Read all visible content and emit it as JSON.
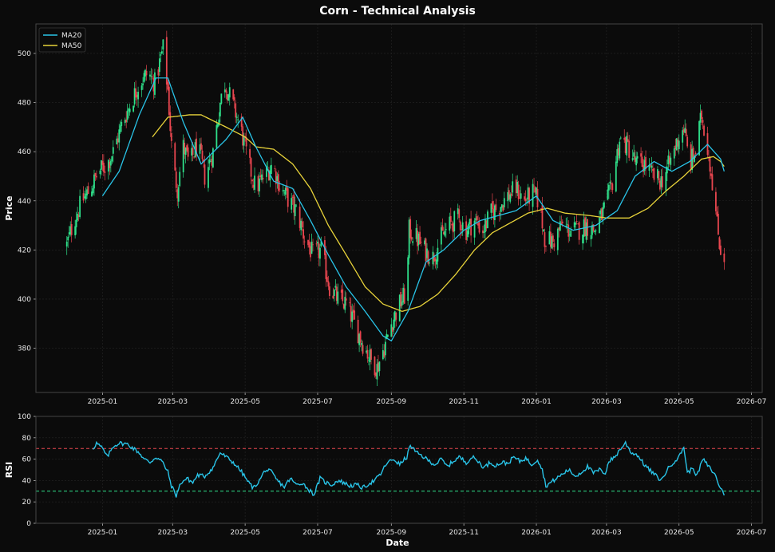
{
  "title": "Corn - Technical Analysis",
  "colors": {
    "background": "#0b0b0b",
    "up": "#2fe08a",
    "down": "#e8464f",
    "ma20": "#29c4e8",
    "ma50": "#e8d33a",
    "rsi": "#29c4e8",
    "overbought": "#e8464f",
    "oversold": "#2fe08a",
    "grid": "#262626",
    "spine": "#444444"
  },
  "chart_data": [
    {
      "type": "candlestick",
      "ylabel": "Price",
      "ylim": [
        362,
        512
      ],
      "xlim": [
        "2024-11-06",
        "2026-07-10"
      ],
      "yticks": [
        380,
        400,
        420,
        440,
        460,
        480,
        500
      ],
      "xticks": [
        "2025-01",
        "2025-03",
        "2025-05",
        "2025-07",
        "2025-09",
        "2025-11",
        "2026-01",
        "2026-03",
        "2026-05",
        "2026-07"
      ],
      "grid": true,
      "legend": {
        "position": "top-left",
        "entries": [
          "MA20",
          "MA50"
        ]
      },
      "close_anchors": [
        [
          "2024-12-02",
          422
        ],
        [
          "2024-12-08",
          432
        ],
        [
          "2024-12-15",
          440
        ],
        [
          "2024-12-22",
          445
        ],
        [
          "2024-12-29",
          452
        ],
        [
          "2025-01-05",
          455
        ],
        [
          "2025-01-10",
          460
        ],
        [
          "2025-01-18",
          472
        ],
        [
          "2025-01-25",
          480
        ],
        [
          "2025-02-01",
          488
        ],
        [
          "2025-02-08",
          492
        ],
        [
          "2025-02-14",
          488
        ],
        [
          "2025-02-18",
          496
        ],
        [
          "2025-02-21",
          502
        ],
        [
          "2025-02-25",
          485
        ],
        [
          "2025-03-01",
          455
        ],
        [
          "2025-03-05",
          445
        ],
        [
          "2025-03-10",
          462
        ],
        [
          "2025-03-15",
          455
        ],
        [
          "2025-03-22",
          463
        ],
        [
          "2025-03-28",
          450
        ],
        [
          "2025-04-04",
          460
        ],
        [
          "2025-04-10",
          480
        ],
        [
          "2025-04-14",
          488
        ],
        [
          "2025-04-20",
          480
        ],
        [
          "2025-04-27",
          470
        ],
        [
          "2025-05-04",
          455
        ],
        [
          "2025-05-10",
          445
        ],
        [
          "2025-05-17",
          450
        ],
        [
          "2025-05-24",
          455
        ],
        [
          "2025-05-31",
          445
        ],
        [
          "2025-06-07",
          440
        ],
        [
          "2025-06-14",
          435
        ],
        [
          "2025-06-20",
          425
        ],
        [
          "2025-06-27",
          418
        ],
        [
          "2025-07-04",
          420
        ],
        [
          "2025-07-11",
          405
        ],
        [
          "2025-07-18",
          400
        ],
        [
          "2025-07-25",
          398
        ],
        [
          "2025-08-01",
          390
        ],
        [
          "2025-08-08",
          382
        ],
        [
          "2025-08-15",
          375
        ],
        [
          "2025-08-20",
          372
        ],
        [
          "2025-08-27",
          382
        ],
        [
          "2025-09-01",
          390
        ],
        [
          "2025-09-08",
          398
        ],
        [
          "2025-09-14",
          403
        ],
        [
          "2025-09-16",
          428
        ],
        [
          "2025-09-22",
          425
        ],
        [
          "2025-09-29",
          420
        ],
        [
          "2025-10-06",
          417
        ],
        [
          "2025-10-13",
          425
        ],
        [
          "2025-10-20",
          430
        ],
        [
          "2025-10-27",
          433
        ],
        [
          "2025-11-03",
          428
        ],
        [
          "2025-11-10",
          432
        ],
        [
          "2025-11-17",
          428
        ],
        [
          "2025-11-24",
          435
        ],
        [
          "2025-12-01",
          438
        ],
        [
          "2025-12-08",
          442
        ],
        [
          "2025-12-15",
          445
        ],
        [
          "2025-12-22",
          440
        ],
        [
          "2025-12-29",
          443
        ],
        [
          "2026-01-03",
          440
        ],
        [
          "2026-01-08",
          425
        ],
        [
          "2026-01-15",
          423
        ],
        [
          "2026-01-22",
          430
        ],
        [
          "2026-01-29",
          428
        ],
        [
          "2026-02-05",
          428
        ],
        [
          "2026-02-12",
          430
        ],
        [
          "2026-02-19",
          428
        ],
        [
          "2026-02-26",
          435
        ],
        [
          "2026-03-05",
          445
        ],
        [
          "2026-03-12",
          465
        ],
        [
          "2026-03-19",
          462
        ],
        [
          "2026-03-26",
          455
        ],
        [
          "2026-04-02",
          455
        ],
        [
          "2026-04-09",
          450
        ],
        [
          "2026-04-16",
          448
        ],
        [
          "2026-04-23",
          455
        ],
        [
          "2026-04-30",
          465
        ],
        [
          "2026-05-05",
          470
        ],
        [
          "2026-05-10",
          455
        ],
        [
          "2026-05-15",
          460
        ],
        [
          "2026-05-20",
          475
        ],
        [
          "2026-05-25",
          462
        ],
        [
          "2026-05-30",
          445
        ],
        [
          "2026-06-02",
          430
        ],
        [
          "2026-06-05",
          420
        ],
        [
          "2026-06-08",
          418
        ]
      ],
      "ma20_anchors": [
        [
          "2025-01-01",
          442
        ],
        [
          "2025-01-15",
          452
        ],
        [
          "2025-02-01",
          475
        ],
        [
          "2025-02-15",
          490
        ],
        [
          "2025-02-25",
          490
        ],
        [
          "2025-03-10",
          472
        ],
        [
          "2025-03-25",
          455
        ],
        [
          "2025-04-15",
          465
        ],
        [
          "2025-04-29",
          474
        ],
        [
          "2025-05-10",
          462
        ],
        [
          "2025-05-25",
          448
        ],
        [
          "2025-06-10",
          445
        ],
        [
          "2025-06-25",
          432
        ],
        [
          "2025-07-10",
          418
        ],
        [
          "2025-07-25",
          405
        ],
        [
          "2025-08-10",
          395
        ],
        [
          "2025-08-25",
          385
        ],
        [
          "2025-09-01",
          383
        ],
        [
          "2025-09-15",
          395
        ],
        [
          "2025-09-30",
          415
        ],
        [
          "2025-10-15",
          420
        ],
        [
          "2025-11-01",
          428
        ],
        [
          "2025-11-15",
          432
        ],
        [
          "2025-12-15",
          436
        ],
        [
          "2026-01-01",
          442
        ],
        [
          "2026-01-15",
          432
        ],
        [
          "2026-02-01",
          428
        ],
        [
          "2026-02-20",
          430
        ],
        [
          "2026-03-10",
          436
        ],
        [
          "2026-03-25",
          450
        ],
        [
          "2026-04-10",
          456
        ],
        [
          "2026-04-25",
          452
        ],
        [
          "2026-05-10",
          456
        ],
        [
          "2026-05-25",
          463
        ],
        [
          "2026-06-05",
          457
        ],
        [
          "2026-06-08",
          452
        ]
      ],
      "ma50_anchors": [
        [
          "2025-02-12",
          466
        ],
        [
          "2025-02-25",
          474
        ],
        [
          "2025-03-15",
          475
        ],
        [
          "2025-03-25",
          475
        ],
        [
          "2025-04-15",
          470
        ],
        [
          "2025-05-01",
          466
        ],
        [
          "2025-05-10",
          462
        ],
        [
          "2025-05-25",
          461
        ],
        [
          "2025-06-10",
          455
        ],
        [
          "2025-06-25",
          445
        ],
        [
          "2025-07-10",
          430
        ],
        [
          "2025-07-25",
          418
        ],
        [
          "2025-08-10",
          405
        ],
        [
          "2025-08-25",
          398
        ],
        [
          "2025-09-10",
          395
        ],
        [
          "2025-09-25",
          397
        ],
        [
          "2025-10-10",
          402
        ],
        [
          "2025-10-25",
          410
        ],
        [
          "2025-11-10",
          420
        ],
        [
          "2025-11-25",
          427
        ],
        [
          "2025-12-10",
          431
        ],
        [
          "2025-12-25",
          435
        ],
        [
          "2026-01-10",
          437
        ],
        [
          "2026-01-25",
          435
        ],
        [
          "2026-02-15",
          434
        ],
        [
          "2026-03-01",
          433
        ],
        [
          "2026-03-20",
          433
        ],
        [
          "2026-04-05",
          437
        ],
        [
          "2026-04-20",
          444
        ],
        [
          "2026-05-05",
          450
        ],
        [
          "2026-05-20",
          457
        ],
        [
          "2026-05-30",
          458
        ],
        [
          "2026-06-05",
          456
        ],
        [
          "2026-06-08",
          454
        ]
      ]
    },
    {
      "type": "line",
      "ylabel": "RSI",
      "xlabel": "Date",
      "ylim": [
        0,
        100
      ],
      "yticks": [
        0,
        20,
        40,
        60,
        80,
        100
      ],
      "xticks": [
        "2025-01",
        "2025-03",
        "2025-05",
        "2025-07",
        "2025-09",
        "2025-11",
        "2026-01",
        "2026-03",
        "2026-05",
        "2026-07"
      ],
      "overbought": 70,
      "oversold": 30,
      "grid": true,
      "rsi_anchors": [
        [
          "2024-12-24",
          70
        ],
        [
          "2024-12-27",
          75
        ],
        [
          "2025-01-01",
          70
        ],
        [
          "2025-01-05",
          62
        ],
        [
          "2025-01-10",
          72
        ],
        [
          "2025-01-15",
          75
        ],
        [
          "2025-01-22",
          74
        ],
        [
          "2025-01-27",
          70
        ],
        [
          "2025-02-01",
          66
        ],
        [
          "2025-02-05",
          60
        ],
        [
          "2025-02-10",
          57
        ],
        [
          "2025-02-15",
          62
        ],
        [
          "2025-02-20",
          58
        ],
        [
          "2025-02-25",
          48
        ],
        [
          "2025-02-28",
          35
        ],
        [
          "2025-03-04",
          26
        ],
        [
          "2025-03-08",
          38
        ],
        [
          "2025-03-13",
          42
        ],
        [
          "2025-03-18",
          38
        ],
        [
          "2025-03-22",
          45
        ],
        [
          "2025-03-28",
          44
        ],
        [
          "2025-04-04",
          52
        ],
        [
          "2025-04-10",
          66
        ],
        [
          "2025-04-15",
          62
        ],
        [
          "2025-04-22",
          56
        ],
        [
          "2025-04-28",
          48
        ],
        [
          "2025-05-04",
          38
        ],
        [
          "2025-05-08",
          33
        ],
        [
          "2025-05-13",
          40
        ],
        [
          "2025-05-18",
          50
        ],
        [
          "2025-05-23",
          48
        ],
        [
          "2025-05-28",
          40
        ],
        [
          "2025-06-03",
          34
        ],
        [
          "2025-06-08",
          42
        ],
        [
          "2025-06-13",
          36
        ],
        [
          "2025-06-18",
          38
        ],
        [
          "2025-06-23",
          32
        ],
        [
          "2025-06-28",
          27
        ],
        [
          "2025-07-03",
          42
        ],
        [
          "2025-07-08",
          38
        ],
        [
          "2025-07-13",
          36
        ],
        [
          "2025-07-18",
          40
        ],
        [
          "2025-07-23",
          38
        ],
        [
          "2025-07-28",
          35
        ],
        [
          "2025-08-03",
          36
        ],
        [
          "2025-08-08",
          33
        ],
        [
          "2025-08-13",
          37
        ],
        [
          "2025-08-18",
          40
        ],
        [
          "2025-08-23",
          46
        ],
        [
          "2025-08-28",
          56
        ],
        [
          "2025-09-03",
          60
        ],
        [
          "2025-09-08",
          55
        ],
        [
          "2025-09-14",
          62
        ],
        [
          "2025-09-17",
          73
        ],
        [
          "2025-09-22",
          66
        ],
        [
          "2025-09-27",
          63
        ],
        [
          "2025-10-03",
          58
        ],
        [
          "2025-10-08",
          55
        ],
        [
          "2025-10-13",
          60
        ],
        [
          "2025-10-18",
          53
        ],
        [
          "2025-10-23",
          58
        ],
        [
          "2025-10-28",
          62
        ],
        [
          "2025-11-03",
          57
        ],
        [
          "2025-11-08",
          62
        ],
        [
          "2025-11-13",
          58
        ],
        [
          "2025-11-18",
          52
        ],
        [
          "2025-11-23",
          57
        ],
        [
          "2025-11-28",
          54
        ],
        [
          "2025-12-03",
          57
        ],
        [
          "2025-12-08",
          56
        ],
        [
          "2025-12-13",
          62
        ],
        [
          "2025-12-18",
          58
        ],
        [
          "2025-12-23",
          61
        ],
        [
          "2025-12-28",
          55
        ],
        [
          "2026-01-02",
          60
        ],
        [
          "2026-01-06",
          50
        ],
        [
          "2026-01-09",
          35
        ],
        [
          "2026-01-13",
          38
        ],
        [
          "2026-01-18",
          42
        ],
        [
          "2026-01-23",
          46
        ],
        [
          "2026-01-28",
          50
        ],
        [
          "2026-02-03",
          44
        ],
        [
          "2026-02-08",
          48
        ],
        [
          "2026-02-13",
          53
        ],
        [
          "2026-02-18",
          47
        ],
        [
          "2026-02-23",
          50
        ],
        [
          "2026-02-28",
          47
        ],
        [
          "2026-03-03",
          58
        ],
        [
          "2026-03-08",
          62
        ],
        [
          "2026-03-13",
          70
        ],
        [
          "2026-03-17",
          75
        ],
        [
          "2026-03-22",
          66
        ],
        [
          "2026-03-27",
          64
        ],
        [
          "2026-04-01",
          56
        ],
        [
          "2026-04-06",
          50
        ],
        [
          "2026-04-11",
          45
        ],
        [
          "2026-04-16",
          40
        ],
        [
          "2026-04-21",
          50
        ],
        [
          "2026-04-26",
          57
        ],
        [
          "2026-05-01",
          62
        ],
        [
          "2026-05-05",
          72
        ],
        [
          "2026-05-08",
          47
        ],
        [
          "2026-05-13",
          52
        ],
        [
          "2026-05-16",
          44
        ],
        [
          "2026-05-21",
          60
        ],
        [
          "2026-05-26",
          53
        ],
        [
          "2026-05-31",
          46
        ],
        [
          "2026-06-04",
          35
        ],
        [
          "2026-06-08",
          27
        ]
      ]
    }
  ]
}
